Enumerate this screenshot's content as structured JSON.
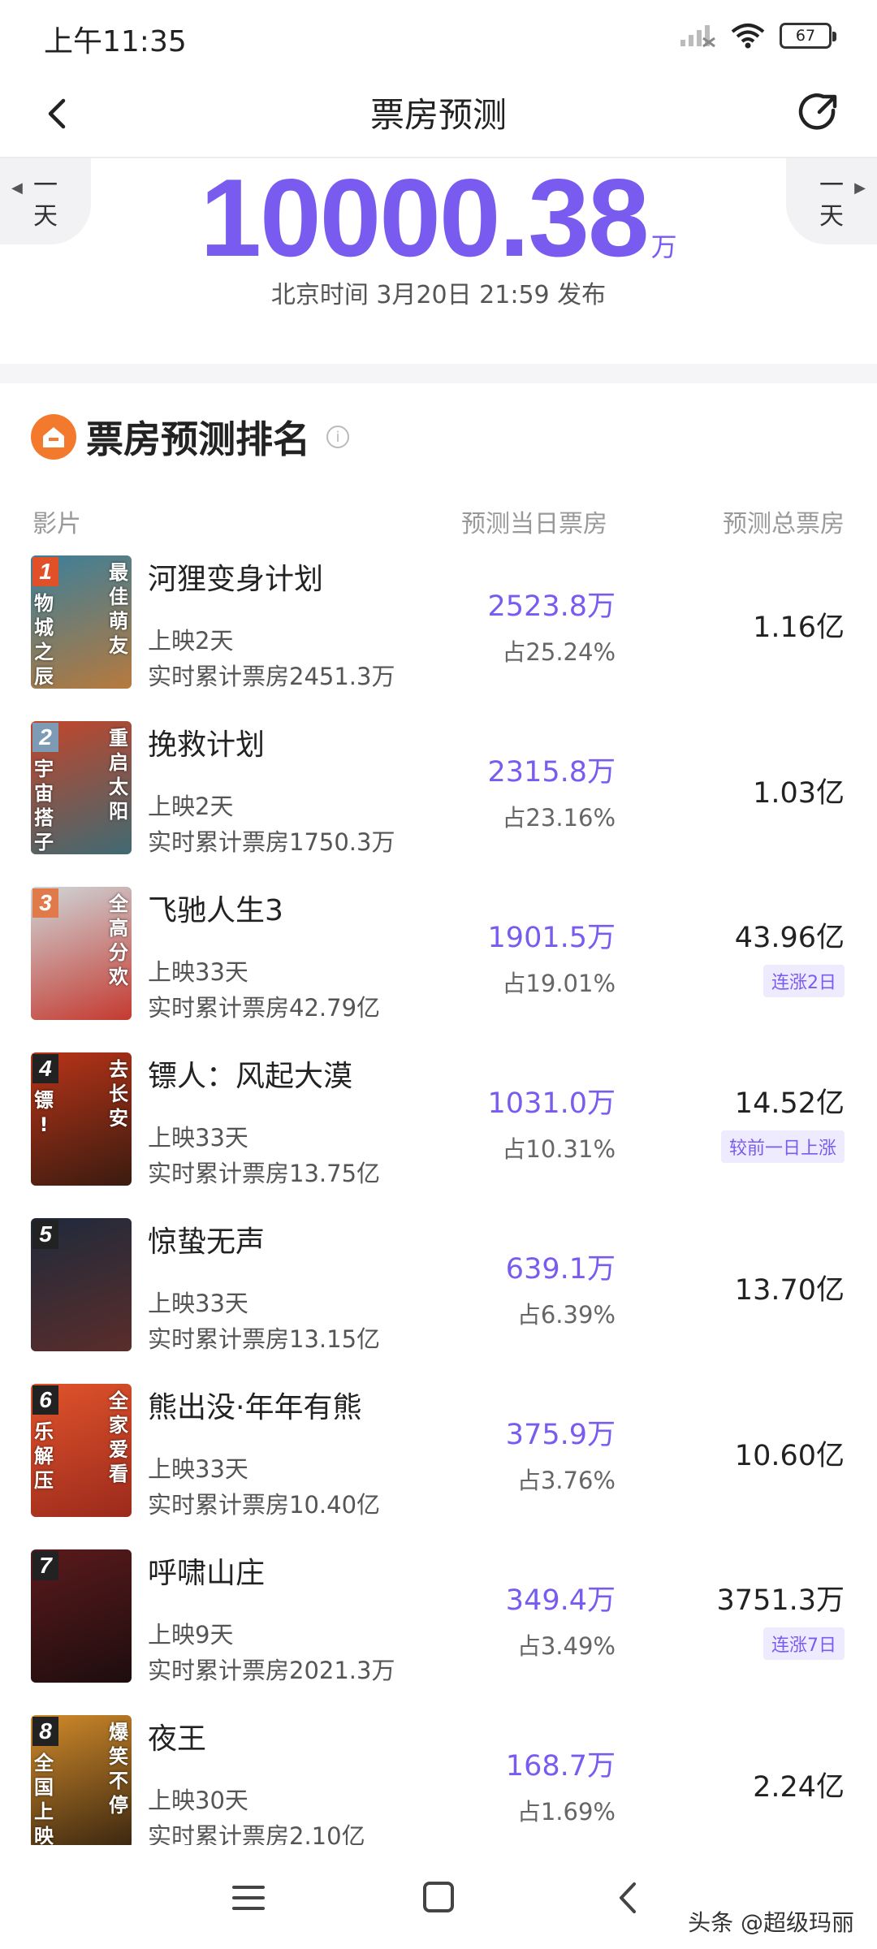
{
  "status_bar": {
    "time": "上午11:35",
    "battery": "67"
  },
  "header": {
    "title": "票房预测"
  },
  "nav_days": {
    "prev": [
      "一",
      "天"
    ],
    "next": [
      "一",
      "天"
    ]
  },
  "summary": {
    "total": "10000.38",
    "unit": "万",
    "publish": "北京时间 3月20日 21:59 发布"
  },
  "ranking": {
    "title": "票房预测排名",
    "columns": {
      "movie": "影片",
      "day_box": "预测当日票房",
      "total_box": "预测总票房"
    },
    "movies": [
      {
        "rank": "1",
        "name": "河狸变身计划",
        "days": "上映2天",
        "cumulative": "实时累计票房2451.3万",
        "day_box": "2523.8万",
        "share": "占25.24%",
        "total": "1.16亿",
        "tag": "",
        "poster_left": "物\n城\n之\n辰",
        "poster_right": "最\n佳\n萌\n友",
        "colors": [
          "#3c7f9a",
          "#b6793d"
        ]
      },
      {
        "rank": "2",
        "name": "挽救计划",
        "days": "上映2天",
        "cumulative": "实时累计票房1750.3万",
        "day_box": "2315.8万",
        "share": "占23.16%",
        "total": "1.03亿",
        "tag": "",
        "poster_left": "宇\n宙\n搭\n子",
        "poster_right": "重\n启\n太\n阳",
        "colors": [
          "#c2452b",
          "#3f6a72"
        ]
      },
      {
        "rank": "3",
        "name": "飞驰人生3",
        "days": "上映33天",
        "cumulative": "实时累计票房42.79亿",
        "day_box": "1901.5万",
        "share": "占19.01%",
        "total": "43.96亿",
        "tag": "连涨2日",
        "poster_left": "",
        "poster_right": "全\n高\n分\n欢",
        "colors": [
          "#cfd6d9",
          "#c43a30"
        ]
      },
      {
        "rank": "4",
        "name": "镖人：风起大漠",
        "days": "上映33天",
        "cumulative": "实时累计票房13.75亿",
        "day_box": "1031.0万",
        "share": "占10.31%",
        "total": "14.52亿",
        "tag": "较前一日上涨",
        "poster_left": "镖\n!",
        "poster_right": "去\n长\n安",
        "colors": [
          "#b83418",
          "#3a1b10"
        ]
      },
      {
        "rank": "5",
        "name": "惊蛰无声",
        "days": "上映33天",
        "cumulative": "实时累计票房13.15亿",
        "day_box": "639.1万",
        "share": "占6.39%",
        "total": "13.70亿",
        "tag": "",
        "poster_left": "",
        "poster_right": "",
        "colors": [
          "#1f2a3c",
          "#5a2d2a"
        ]
      },
      {
        "rank": "6",
        "name": "熊出没·年年有熊",
        "days": "上映33天",
        "cumulative": "实时累计票房10.40亿",
        "day_box": "375.9万",
        "share": "占3.76%",
        "total": "10.60亿",
        "tag": "",
        "poster_left": "乐\n解\n压",
        "poster_right": "全\n家\n爱\n看",
        "colors": [
          "#e0532b",
          "#9b2a1c"
        ]
      },
      {
        "rank": "7",
        "name": "呼啸山庄",
        "days": "上映9天",
        "cumulative": "实时累计票房2021.3万",
        "day_box": "349.4万",
        "share": "占3.49%",
        "total": "3751.3万",
        "tag": "连涨7日",
        "poster_left": "",
        "poster_right": "",
        "colors": [
          "#5a1a1c",
          "#1e0d0e"
        ]
      },
      {
        "rank": "8",
        "name": "夜王",
        "days": "上映30天",
        "cumulative": "实时累计票房2.10亿",
        "day_box": "168.7万",
        "share": "占1.69%",
        "total": "2.24亿",
        "tag": "",
        "poster_left": "全\n国\n上\n映",
        "poster_right": "爆\n笑\n不\n停",
        "colors": [
          "#d08a2a",
          "#3a2610"
        ]
      }
    ]
  },
  "watermark": "头条 @超级玛丽"
}
